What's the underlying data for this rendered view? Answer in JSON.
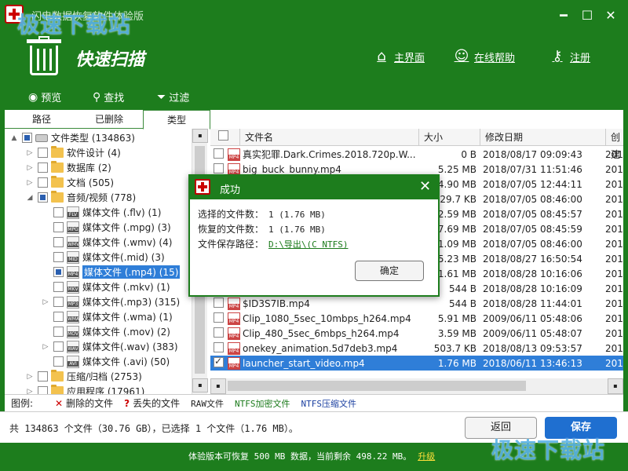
{
  "app": {
    "title": "闪电数据恢复软件体验版",
    "watermark": "极速下载站",
    "header_title": "快速扫描",
    "nav": [
      {
        "label": "主界面",
        "icon": "home-icon"
      },
      {
        "label": "在线帮助",
        "icon": "user-help-icon"
      },
      {
        "label": "注册",
        "icon": "key-icon"
      }
    ],
    "window_buttons": [
      "minimize",
      "maximize",
      "close"
    ]
  },
  "toolbar": {
    "preview": "预览",
    "search": "查找",
    "filter": "过滤"
  },
  "left_tabs": [
    "路径",
    "已删除",
    "类型"
  ],
  "active_left_tab": 2,
  "tree": [
    {
      "label": "文件类型 (134863)",
      "level": 0,
      "expander": "▲",
      "check": "partial",
      "icon": "drive"
    },
    {
      "label": "软件设计 (4)",
      "level": 1,
      "expander": "▷",
      "check": "none",
      "icon": "folder"
    },
    {
      "label": "数据库 (2)",
      "level": 1,
      "expander": "▷",
      "check": "none",
      "icon": "folder"
    },
    {
      "label": "文档 (505)",
      "level": 1,
      "expander": "▷",
      "check": "none",
      "icon": "folder"
    },
    {
      "label": "音频/视频 (778)",
      "level": 1,
      "expander": "◢",
      "check": "partial",
      "icon": "folder"
    },
    {
      "label": "媒体文件 (.flv) (1)",
      "level": 2,
      "expander": "",
      "check": "none",
      "icon": "FLV"
    },
    {
      "label": "媒体文件 (.mpg) (3)",
      "level": 2,
      "expander": "",
      "check": "none",
      "icon": "MPG"
    },
    {
      "label": "媒体文件 (.wmv) (4)",
      "level": 2,
      "expander": "",
      "check": "none",
      "icon": "WMV"
    },
    {
      "label": "媒体文件(.mid) (3)",
      "level": 2,
      "expander": "",
      "check": "none",
      "icon": "MID"
    },
    {
      "label": "媒体文件 (.mp4) (15)",
      "level": 2,
      "expander": "",
      "check": "partial",
      "icon": "MP4",
      "selected": true
    },
    {
      "label": "媒体文件 (.mkv) (1)",
      "level": 2,
      "expander": "",
      "check": "none",
      "icon": "MKV"
    },
    {
      "label": "媒体文件(.mp3) (315)",
      "level": 2,
      "expander": "▷",
      "check": "none",
      "icon": "MP3"
    },
    {
      "label": "媒体文件 (.wma) (1)",
      "level": 2,
      "expander": "",
      "check": "none",
      "icon": "WMA"
    },
    {
      "label": "媒体文件 (.mov) (2)",
      "level": 2,
      "expander": "",
      "check": "none",
      "icon": "MOV"
    },
    {
      "label": "媒体文件(.wav) (383)",
      "level": 2,
      "expander": "▷",
      "check": "none",
      "icon": "WAV"
    },
    {
      "label": "媒体文件 (.avi) (50)",
      "level": 2,
      "expander": "",
      "check": "none",
      "icon": "AVI"
    },
    {
      "label": "压缩/归档 (2753)",
      "level": 1,
      "expander": "▷",
      "check": "none",
      "icon": "folder"
    },
    {
      "label": "应用程序 (17961)",
      "level": 1,
      "expander": "▷",
      "check": "none",
      "icon": "folder"
    }
  ],
  "list_columns": [
    "文件名",
    "大小",
    "修改日期",
    "创建"
  ],
  "files": [
    {
      "name": "真实犯罪.Dark.Crimes.2018.720p.W...",
      "size": "0 B",
      "date": "2018/08/17 09:09:43",
      "created": "201"
    },
    {
      "name": "big_buck_bunny.mp4",
      "size": "5.25 MB",
      "date": "2018/07/31 11:51:46",
      "created": "201"
    },
    {
      "name": "",
      "size": "4.90 MB",
      "date": "2018/07/05 12:44:11",
      "created": "201"
    },
    {
      "name": "",
      "size": "29.7 KB",
      "date": "2018/07/05 08:46:00",
      "created": "201"
    },
    {
      "name": "",
      "size": "2.59 MB",
      "date": "2018/07/05 08:45:57",
      "created": "201"
    },
    {
      "name": "",
      "size": "7.69 MB",
      "date": "2018/07/05 08:45:59",
      "created": "201"
    },
    {
      "name": "",
      "size": "1.09 MB",
      "date": "2018/07/05 08:46:00",
      "created": "201"
    },
    {
      "name": "",
      "size": "5.23 MB",
      "date": "2018/08/27 16:50:54",
      "created": "201"
    },
    {
      "name": "",
      "size": "1.61 MB",
      "date": "2018/08/28 10:16:06",
      "created": "201"
    },
    {
      "name": "",
      "size": "544 B",
      "date": "2018/08/28 10:16:09",
      "created": "201"
    },
    {
      "name": "$ID3S7IB.mp4",
      "size": "544 B",
      "date": "2018/08/28 11:44:01",
      "created": "201"
    },
    {
      "name": "Clip_1080_5sec_10mbps_h264.mp4",
      "size": "5.91 MB",
      "date": "2009/06/11 05:48:06",
      "created": "201"
    },
    {
      "name": "Clip_480_5sec_6mbps_h264.mp4",
      "size": "3.59 MB",
      "date": "2009/06/11 05:48:07",
      "created": "201"
    },
    {
      "name": "onekey_animation.5d7deb3.mp4",
      "size": "503.7 KB",
      "date": "2018/08/13 09:53:57",
      "created": "201"
    },
    {
      "name": "launcher_start_video.mp4",
      "size": "1.76 MB",
      "date": "2018/06/11 13:46:13",
      "created": "201",
      "selected": true,
      "checked": true
    }
  ],
  "legend": {
    "label": "图例:",
    "deleted": "删除的文件",
    "lost": "丢失的文件",
    "raw": "RAW文件",
    "ntfs_enc": "NTFS加密文件",
    "ntfs_cmp": "NTFS压缩文件"
  },
  "summary": "共 134863 个文件（30.76 GB），已选择 1 个文件（1.76 MB）。",
  "buttons": {
    "back": "返回",
    "save": "保存"
  },
  "footer": {
    "text": "体验版本可恢复 500 MB 数据，当前剩余 498.22 MB。",
    "upgrade": "升级"
  },
  "dialog": {
    "title": "成功",
    "selected_label": "选择的文件数：",
    "selected_value": "1 (1.76 MB)",
    "recovered_label": "恢复的文件数：",
    "recovered_value": "1 (1.76 MB)",
    "path_label": "文件保存路径：",
    "path_value": "D:\\导出\\(C NTFS)",
    "ok": "确定"
  }
}
